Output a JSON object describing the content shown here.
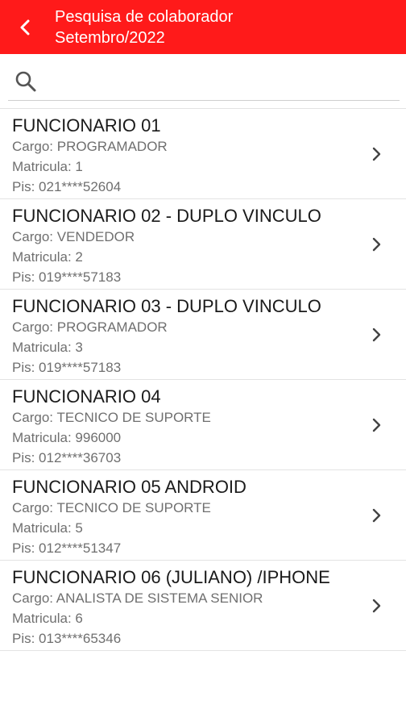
{
  "header": {
    "title": "Pesquisa de colaborador",
    "subtitle": "Setembro/2022",
    "background_color": "#ff1a1a",
    "back_icon": "chevron-left-icon"
  },
  "search": {
    "placeholder": "",
    "value": "",
    "icon": "search-icon"
  },
  "employees": [
    {
      "name": "FUNCIONARIO 01",
      "cargo": "Cargo: PROGRAMADOR",
      "matricula": "Matricula: 1",
      "pis": "Pis: 021****52604"
    },
    {
      "name": "FUNCIONARIO 02 - DUPLO VINCULO",
      "cargo": "Cargo: VENDEDOR",
      "matricula": "Matricula: 2",
      "pis": "Pis: 019****57183"
    },
    {
      "name": "FUNCIONARIO 03 - DUPLO VINCULO",
      "cargo": "Cargo: PROGRAMADOR",
      "matricula": "Matricula: 3",
      "pis": "Pis: 019****57183"
    },
    {
      "name": "FUNCIONARIO 04",
      "cargo": "Cargo: TECNICO DE SUPORTE",
      "matricula": "Matricula: 996000",
      "pis": "Pis: 012****36703"
    },
    {
      "name": "FUNCIONARIO 05 ANDROID",
      "cargo": "Cargo: TECNICO DE SUPORTE",
      "matricula": "Matricula: 5",
      "pis": "Pis: 012****51347"
    },
    {
      "name": "FUNCIONARIO 06 (JULIANO) /IPHONE",
      "cargo": "Cargo: ANALISTA DE SISTEMA SENIOR",
      "matricula": "Matricula: 6",
      "pis": "Pis: 013****65346"
    }
  ]
}
